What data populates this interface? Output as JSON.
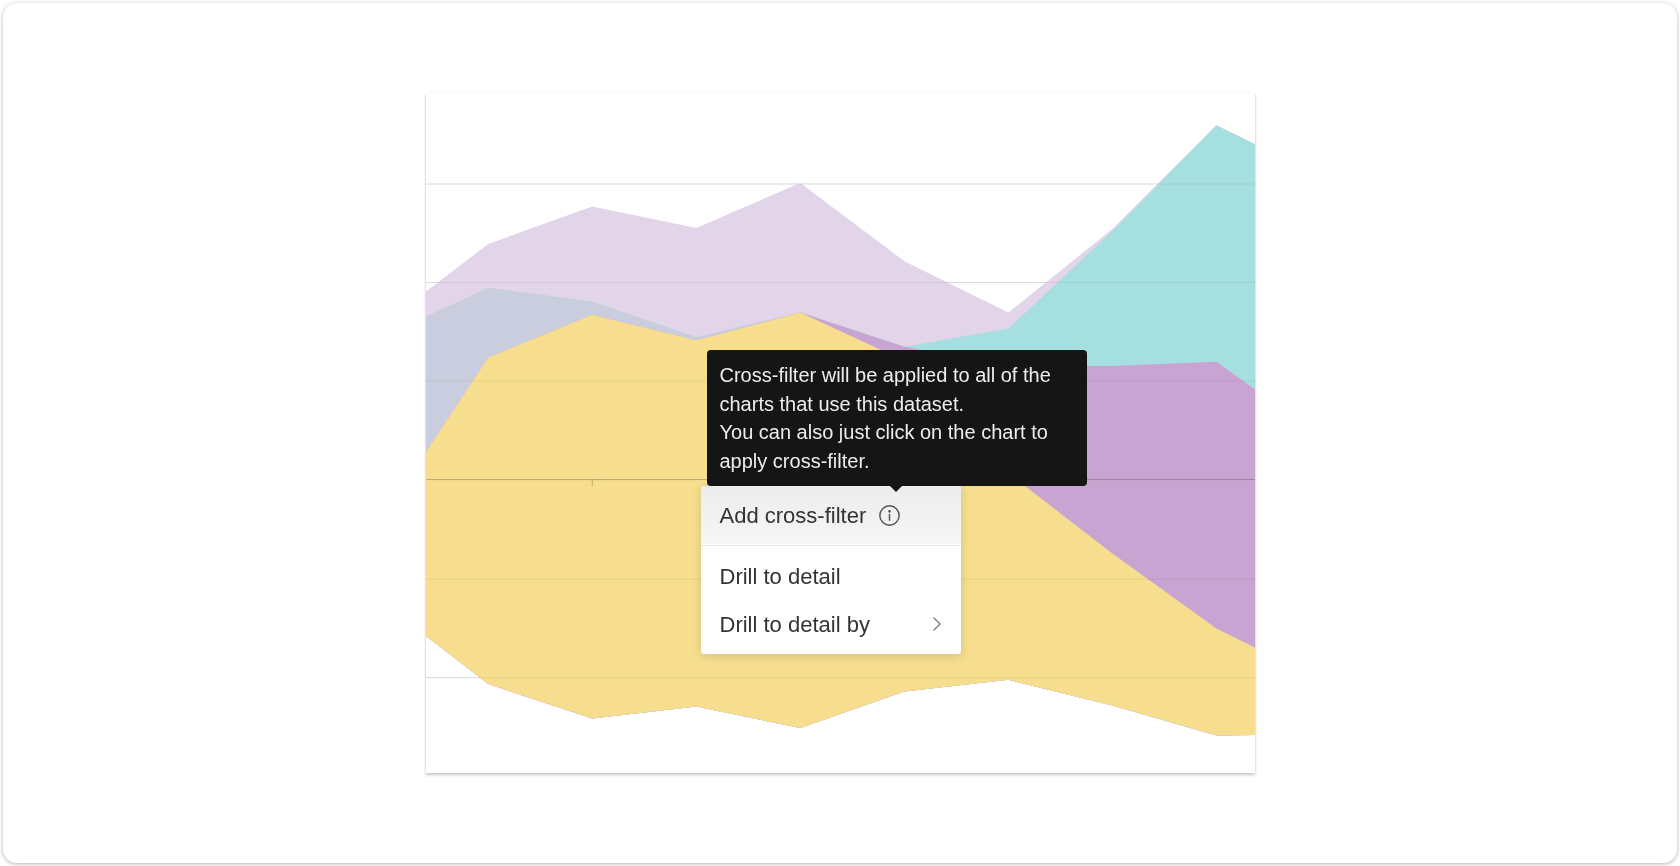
{
  "chart": {
    "kind": "stream"
  },
  "tooltip": {
    "paragraphs": [
      "Cross-filter will be applied to all of the charts that use this dataset.",
      "You can also just click on the chart to apply cross-filter."
    ]
  },
  "menu": {
    "sections": [
      {
        "items": [
          {
            "label": "Add cross-filter",
            "kind": "info",
            "highlighted": true
          }
        ]
      },
      {
        "items": [
          {
            "label": "Drill to detail",
            "kind": "plain",
            "highlighted": false
          },
          {
            "label": "Drill to detail by",
            "kind": "submenu",
            "highlighted": false
          }
        ]
      }
    ]
  }
}
